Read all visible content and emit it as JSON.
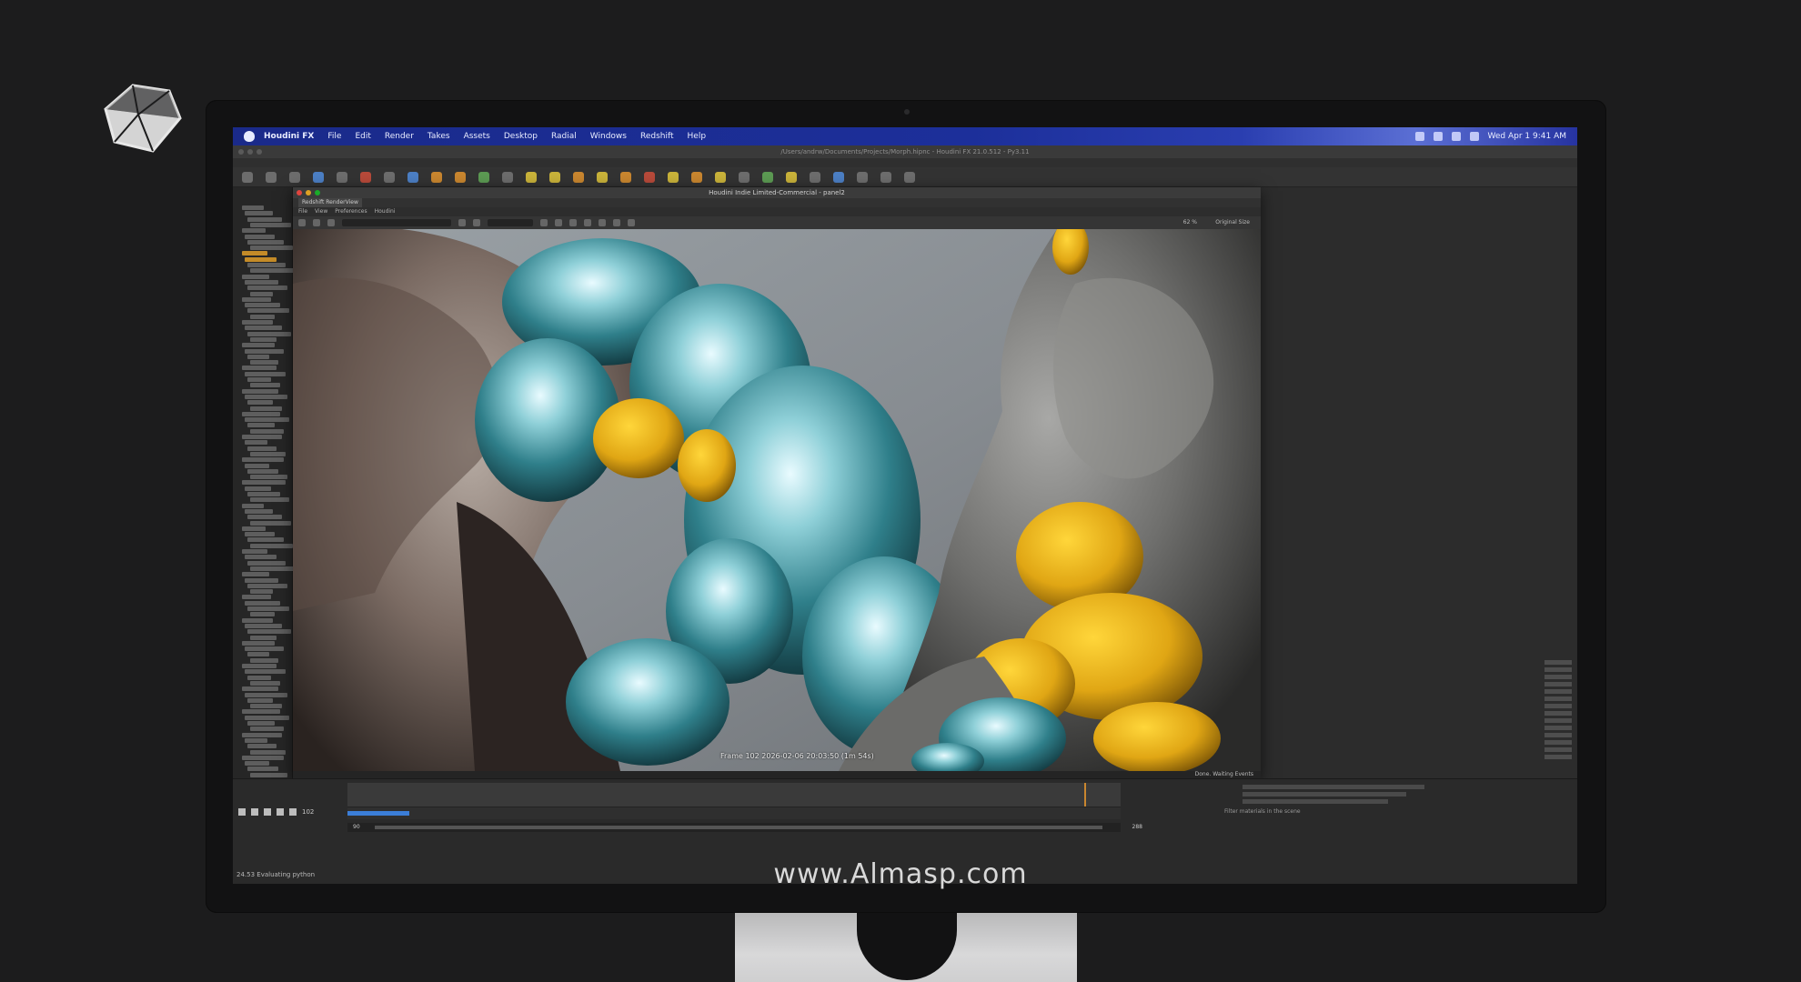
{
  "menubar": {
    "app": "Houdini FX",
    "items": [
      "File",
      "Edit",
      "Render",
      "Takes",
      "Assets",
      "Desktop",
      "Radial",
      "Windows",
      "Redshift",
      "Help"
    ],
    "clock": "Wed Apr 1  9:41 AM"
  },
  "window": {
    "title": "/Users/andrw/Documents/Projects/Morph.hipnc - Houdini FX 21.0.512 - Py3.11"
  },
  "panel": {
    "title": "Houdini Indie Limited-Commercial - panel2",
    "tab": "Redshift RenderView",
    "menu": [
      "File",
      "View",
      "Preferences",
      "Houdini"
    ],
    "zoom": "62 %",
    "size_mode": "Original Size",
    "frame_caption": "Frame 102  2026-02-06  20:03:50  (1m 54s)",
    "status": "Done. Waiting Events"
  },
  "timeline": {
    "current_frame": "102",
    "start": "90",
    "end": "288",
    "progress": 0.08
  },
  "status_bar": {
    "text": "24.53 Evaluating python"
  },
  "filter": {
    "placeholder": "Filter materials in the scene"
  },
  "colors": {
    "menubar": "#1c2f9a",
    "accent": "#c48b28",
    "timeline_progress": "#3b7ed8"
  },
  "watermark": "www.Almasp.com"
}
